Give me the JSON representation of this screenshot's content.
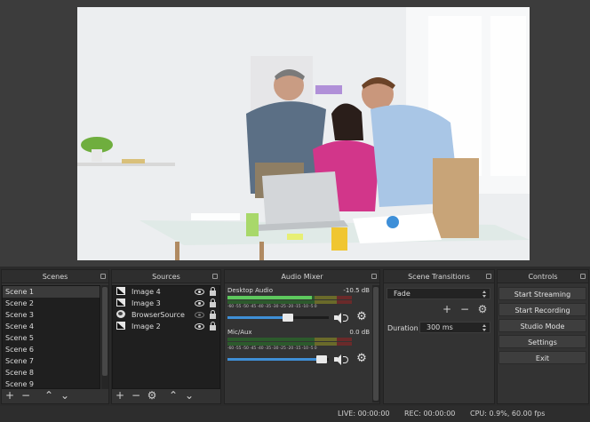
{
  "panels": {
    "scenes": "Scenes",
    "sources": "Sources",
    "mixer": "Audio Mixer",
    "transitions": "Scene Transitions",
    "controls": "Controls"
  },
  "scenes": [
    "Scene 1",
    "Scene 2",
    "Scene 3",
    "Scene 4",
    "Scene 5",
    "Scene 6",
    "Scene 7",
    "Scene 8",
    "Scene 9"
  ],
  "sources": [
    {
      "label": "Image 4",
      "icon": "image-icon"
    },
    {
      "label": "Image 3",
      "icon": "image-icon"
    },
    {
      "label": "BrowserSource",
      "icon": "globe-icon",
      "hidden": true
    },
    {
      "label": "Image 2",
      "icon": "image-icon"
    }
  ],
  "mixer": {
    "channels": [
      {
        "name": "Desktop Audio",
        "db": "-10.5 dB",
        "volume": 0.6
      },
      {
        "name": "Mic/Aux",
        "db": "0.0 dB",
        "volume": 0.93
      }
    ],
    "scale": "-60 -55 -50 -45 -40 -35 -30 -25 -20 -15 -10 -5 0"
  },
  "transitions": {
    "selected": "Fade",
    "duration_label": "Duration",
    "duration_value": "300 ms"
  },
  "controls": {
    "start_streaming": "Start Streaming",
    "start_recording": "Start Recording",
    "studio_mode": "Studio Mode",
    "settings": "Settings",
    "exit": "Exit"
  },
  "status": {
    "live": "LIVE: 00:00:00",
    "rec": "REC: 00:00:00",
    "cpu": "CPU: 0.9%, 60.00 fps"
  },
  "colors": {
    "accent": "#3f8fd6",
    "panel_bg": "#333333",
    "list_bg": "#1f1f1f"
  }
}
